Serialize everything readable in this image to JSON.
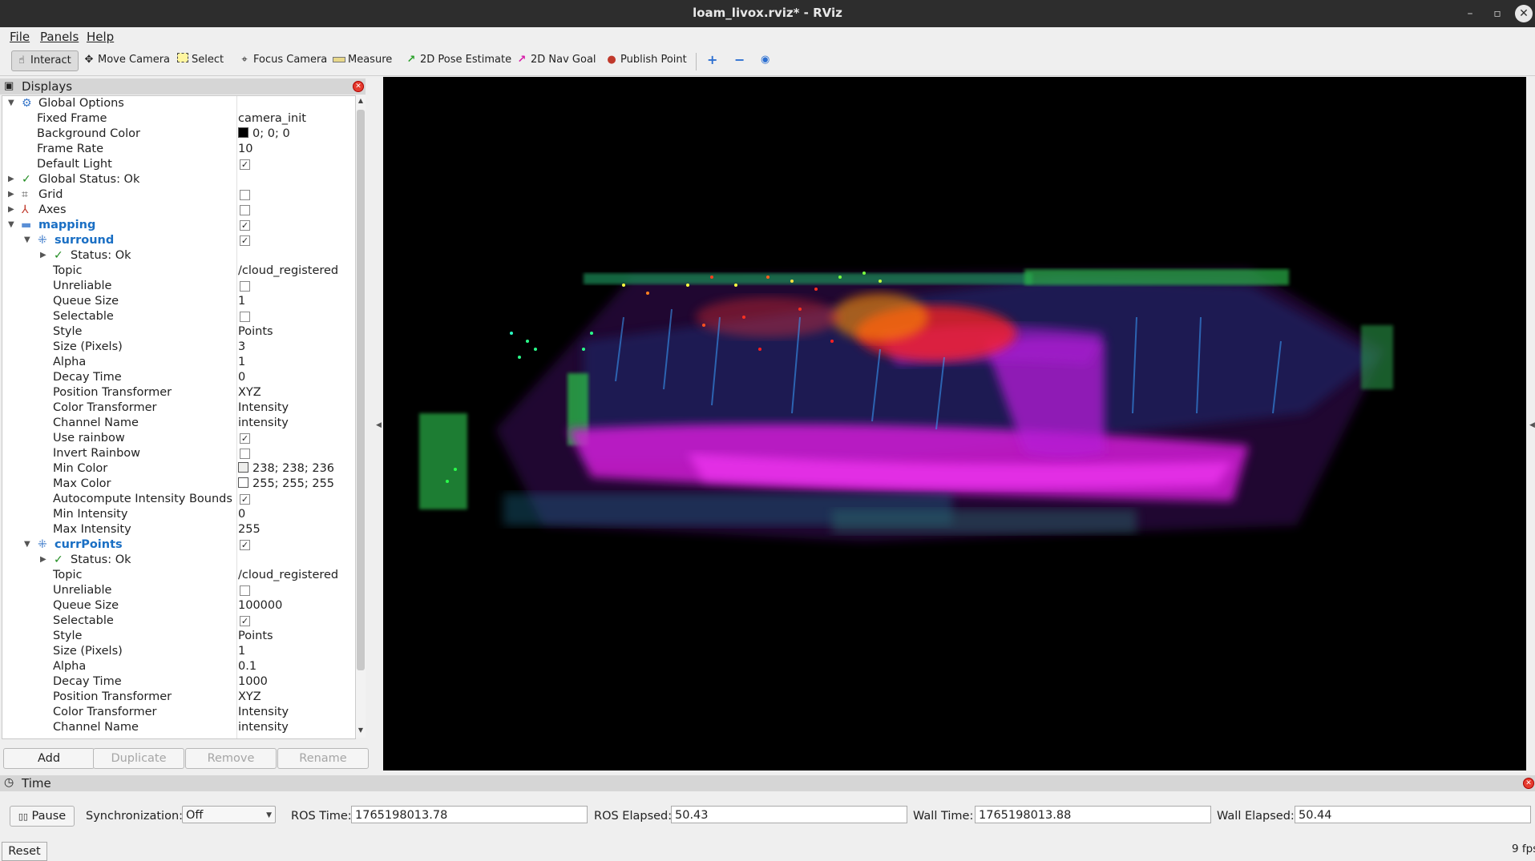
{
  "window": {
    "title": "loam_livox.rviz* - RViz",
    "minimize": "–",
    "maximize": "▫",
    "close": "✕"
  },
  "menu": {
    "file": "File",
    "panels": "Panels",
    "help": "Help"
  },
  "toolbar": {
    "interact": "Interact",
    "move_camera": "Move Camera",
    "select": "Select",
    "focus_camera": "Focus Camera",
    "measure": "Measure",
    "pose_estimate": "2D Pose Estimate",
    "nav_goal": "2D Nav Goal",
    "publish_point": "Publish Point",
    "add_tool": "+",
    "remove_tool": "−",
    "view_tool": "◉"
  },
  "displays": {
    "title": "Displays",
    "rows": [
      {
        "name": "Global Options",
        "value": ""
      },
      {
        "name": "Fixed Frame",
        "value": "camera_init"
      },
      {
        "name": "Background Color",
        "value": "0; 0; 0"
      },
      {
        "name": "Frame Rate",
        "value": "10"
      },
      {
        "name": "Default Light",
        "value": ""
      },
      {
        "name": "Global Status: Ok",
        "value": ""
      },
      {
        "name": "Grid",
        "value": ""
      },
      {
        "name": "Axes",
        "value": ""
      },
      {
        "name": "mapping",
        "value": ""
      },
      {
        "name": "surround",
        "value": ""
      },
      {
        "name": "Status: Ok",
        "value": ""
      },
      {
        "name": "Topic",
        "value": "/cloud_registered"
      },
      {
        "name": "Unreliable",
        "value": ""
      },
      {
        "name": "Queue Size",
        "value": "1"
      },
      {
        "name": "Selectable",
        "value": ""
      },
      {
        "name": "Style",
        "value": "Points"
      },
      {
        "name": "Size (Pixels)",
        "value": "3"
      },
      {
        "name": "Alpha",
        "value": "1"
      },
      {
        "name": "Decay Time",
        "value": "0"
      },
      {
        "name": "Position Transformer",
        "value": "XYZ"
      },
      {
        "name": "Color Transformer",
        "value": "Intensity"
      },
      {
        "name": "Channel Name",
        "value": "intensity"
      },
      {
        "name": "Use rainbow",
        "value": ""
      },
      {
        "name": "Invert Rainbow",
        "value": ""
      },
      {
        "name": "Min Color",
        "value": "238; 238; 236"
      },
      {
        "name": "Max Color",
        "value": "255; 255; 255"
      },
      {
        "name": "Autocompute Intensity Bounds",
        "value": ""
      },
      {
        "name": "Min Intensity",
        "value": "0"
      },
      {
        "name": "Max Intensity",
        "value": "255"
      },
      {
        "name": "currPoints",
        "value": ""
      },
      {
        "name": "Status: Ok",
        "value": ""
      },
      {
        "name": "Topic",
        "value": "/cloud_registered"
      },
      {
        "name": "Unreliable",
        "value": ""
      },
      {
        "name": "Queue Size",
        "value": "100000"
      },
      {
        "name": "Selectable",
        "value": ""
      },
      {
        "name": "Style",
        "value": "Points"
      },
      {
        "name": "Size (Pixels)",
        "value": "1"
      },
      {
        "name": "Alpha",
        "value": "0.1"
      },
      {
        "name": "Decay Time",
        "value": "1000"
      },
      {
        "name": "Position Transformer",
        "value": "XYZ"
      },
      {
        "name": "Color Transformer",
        "value": "Intensity"
      },
      {
        "name": "Channel Name",
        "value": "intensity"
      }
    ],
    "buttons": {
      "add": "Add",
      "duplicate": "Duplicate",
      "remove": "Remove",
      "rename": "Rename"
    }
  },
  "time_panel": {
    "title": "Time",
    "pause": "Pause",
    "sync_label": "Synchronization:",
    "sync_value": "Off",
    "ros_time_label": "ROS Time:",
    "ros_time": "1765198013.78",
    "ros_elapsed_label": "ROS Elapsed:",
    "ros_elapsed": "50.43",
    "wall_time_label": "Wall Time:",
    "wall_time": "1765198013.88",
    "wall_elapsed_label": "Wall Elapsed:",
    "wall_elapsed": "50.44"
  },
  "status": {
    "reset": "Reset",
    "fps": "9 fps"
  },
  "colors": {
    "viewport_bg": "#000000",
    "accent_blue": "#1a6fc4",
    "close_red": "#e63b2e"
  }
}
